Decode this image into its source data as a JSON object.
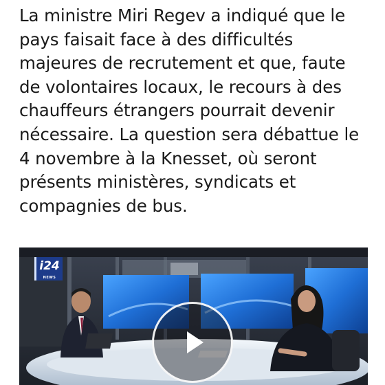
{
  "article": {
    "lines": [
      "La ministre Miri Regev a indiqué que le",
      "pays faisait face à des difficultés",
      "majeures de recrutement et que, faute",
      "de volontaires locaux, le recours à des",
      "chauffeurs étrangers pourrait devenir",
      "nécessaire. La question sera débattue le",
      "4 novembre à la Knesset, où seront",
      "présents ministères, syndicats et",
      "compagnies de bus."
    ]
  },
  "video": {
    "channel_logo": "i24",
    "channel_logo_sub": "NEWS",
    "play_icon": "play-icon",
    "colors": {
      "screen_blue": "#2a7be0",
      "studio_dark": "#2a2f38",
      "desk_white": "#e8eef5"
    }
  }
}
